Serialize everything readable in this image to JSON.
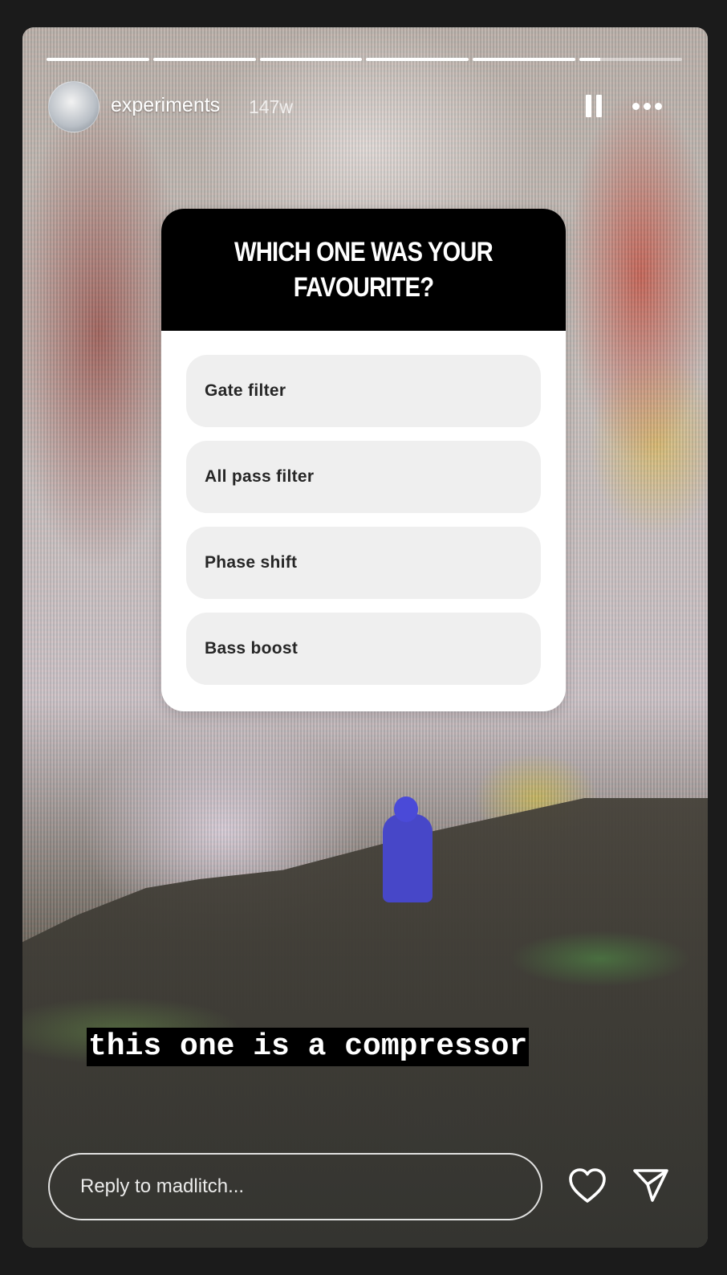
{
  "story": {
    "username": "experiments",
    "time_ago": "147w",
    "progress_segments": [
      1,
      1,
      1,
      1,
      1,
      0.2
    ]
  },
  "poll": {
    "question": "WHICH ONE WAS YOUR FAVOURITE?",
    "options": [
      "Gate filter",
      "All pass filter",
      "Phase shift",
      "Bass boost"
    ]
  },
  "caption": "this one is a compressor",
  "reply": {
    "placeholder": "Reply to madlitch..."
  },
  "icons": {
    "pause": "pause-icon",
    "more": "more-options-icon",
    "heart": "heart-icon",
    "send": "send-icon"
  }
}
